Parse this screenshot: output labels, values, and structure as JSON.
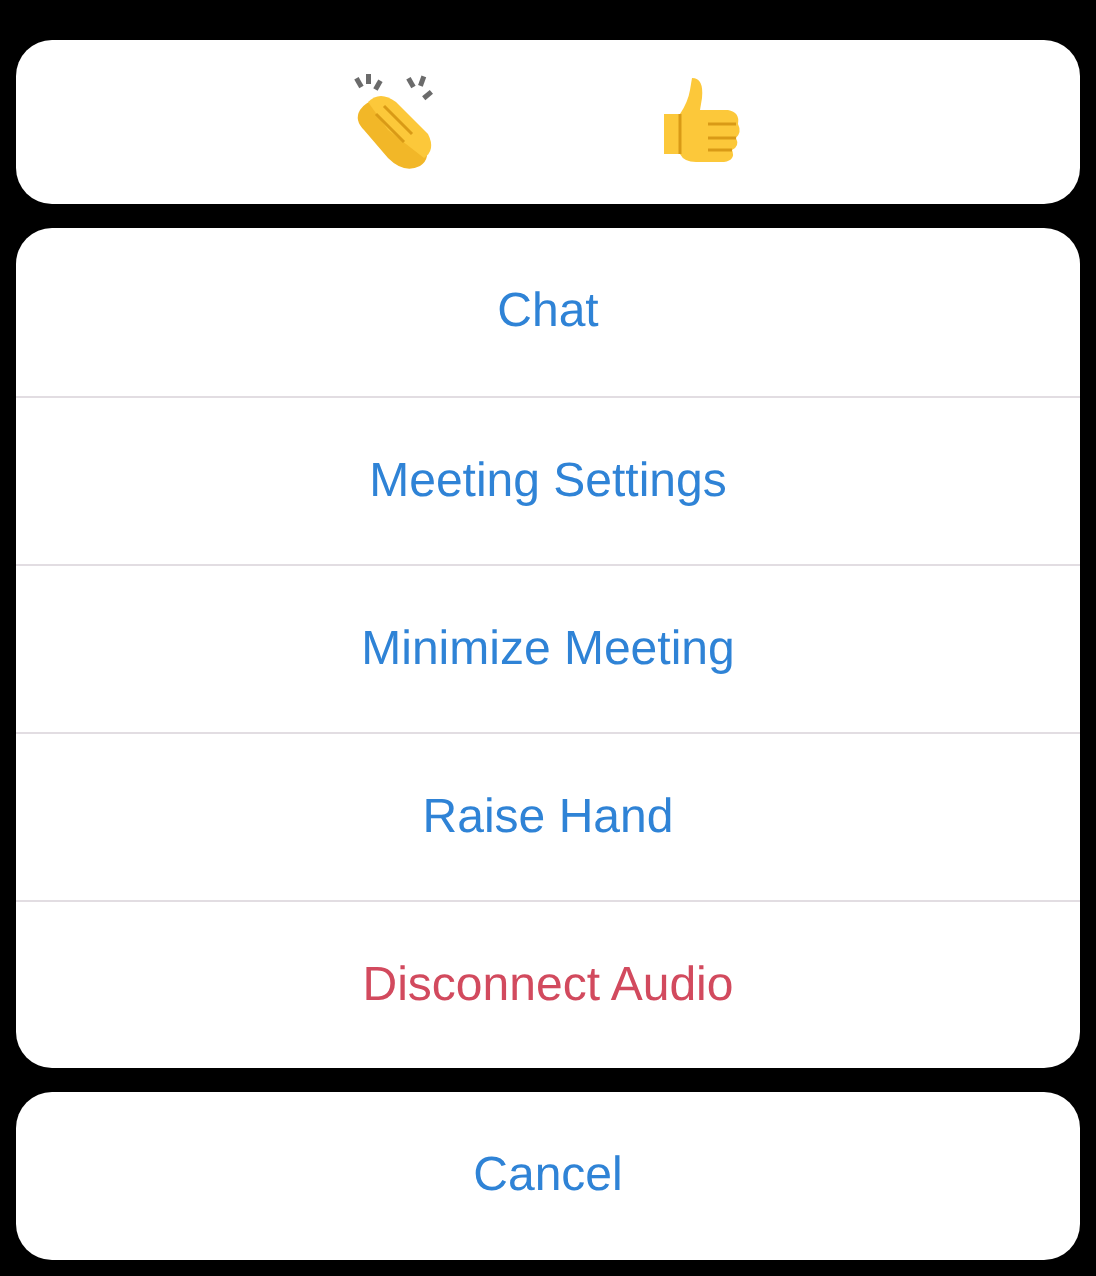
{
  "reactions": [
    {
      "kind": "clap"
    },
    {
      "kind": "thumbs_up"
    }
  ],
  "actions": [
    {
      "label": "Chat",
      "kind": "default"
    },
    {
      "label": "Meeting Settings",
      "kind": "default"
    },
    {
      "label": "Minimize Meeting",
      "kind": "default"
    },
    {
      "label": "Raise Hand",
      "kind": "default"
    },
    {
      "label": "Disconnect Audio",
      "kind": "destructive"
    }
  ],
  "cancel": {
    "label": "Cancel"
  }
}
